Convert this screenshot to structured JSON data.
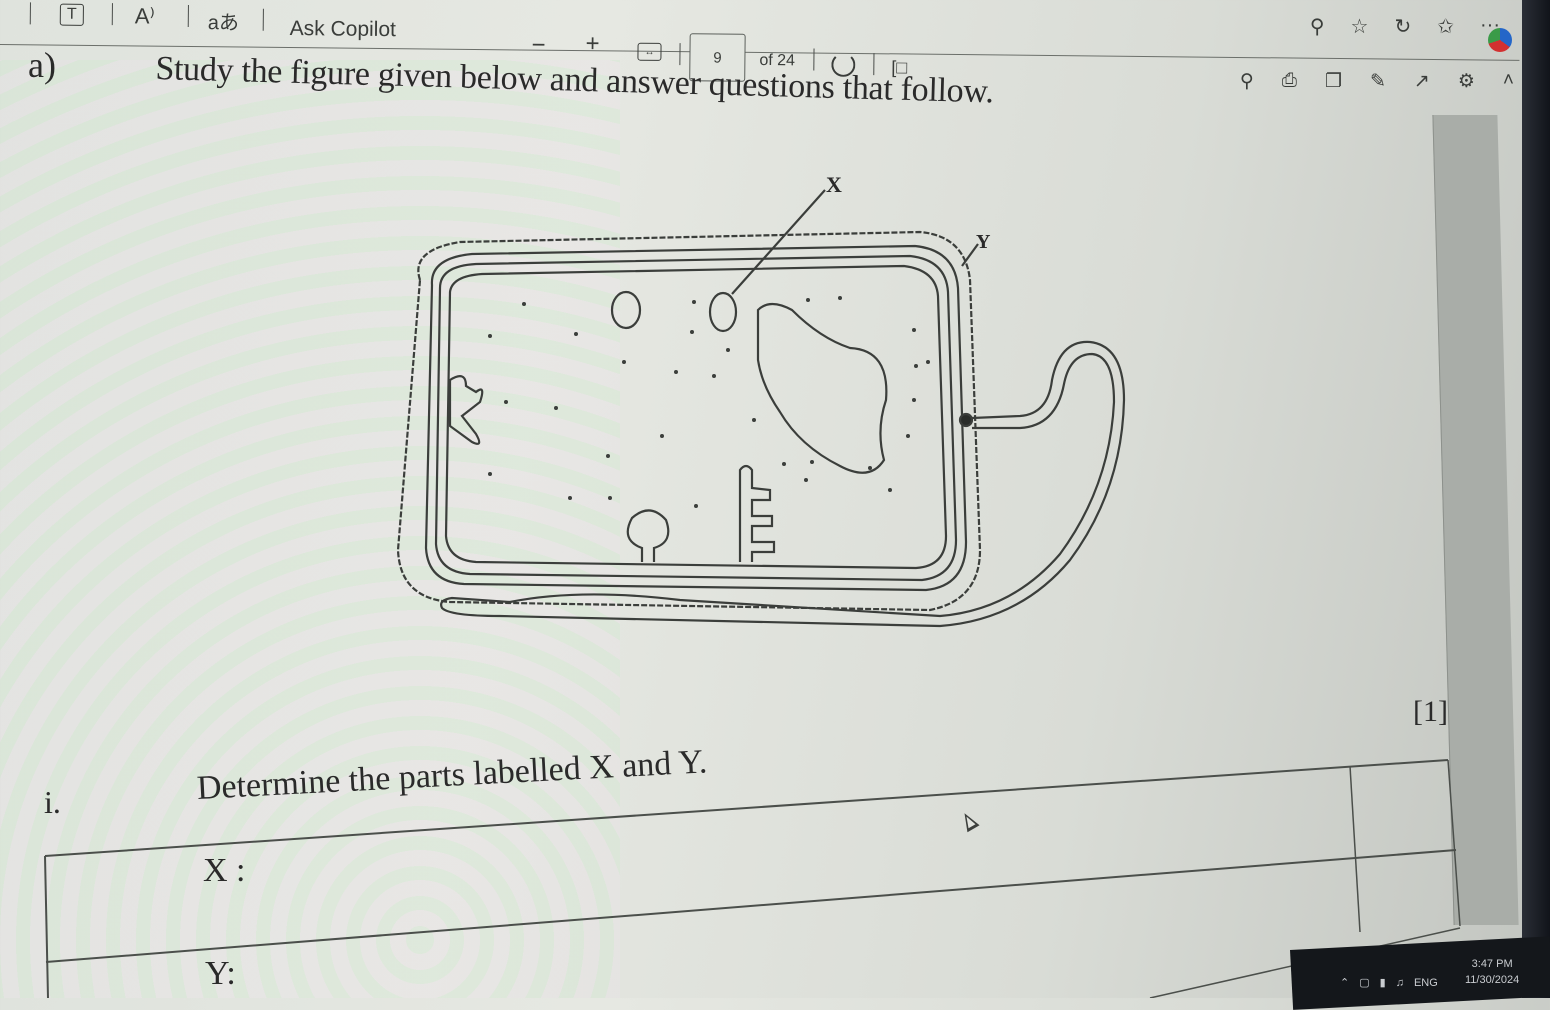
{
  "toolbar": {
    "icons": {
      "text_options": "T",
      "read_aloud": "A⁾",
      "translate": "aあ",
      "zoom_out": "−",
      "zoom_in": "+",
      "fit_width": "↔",
      "rotate": "↻",
      "page_view": "[□"
    },
    "ask_copilot": "Ask Copilot",
    "page_number": "9",
    "page_total": "of 24"
  },
  "browser_icons": {
    "row1": [
      "⚲",
      "☆",
      "↻",
      "✩",
      "···"
    ],
    "row1_names": [
      "search-page-icon",
      "favorite-star-icon",
      "refresh-icon",
      "favorites-bar-icon",
      "more-options-icon"
    ],
    "row2": [
      "⚲",
      "⎙",
      "❐",
      "✎",
      "↗",
      "⚙",
      "˄"
    ],
    "row2_names": [
      "find-icon",
      "print-icon",
      "save-icon",
      "save-as-icon",
      "draw-icon",
      "settings-icon",
      "collapse-toolbar-icon"
    ]
  },
  "document": {
    "part_label": "a)",
    "heading": "Study the figure given below and answer questions that follow.",
    "figure_labels": {
      "x": "X",
      "y": "Y"
    },
    "marks": "[1]",
    "question_number": "i.",
    "question_text": "Determine the parts labelled X and Y.",
    "answers": {
      "x_label": "X :",
      "y_label": "Y:"
    }
  },
  "taskbar": {
    "language": "ENG",
    "time": "3:47 PM",
    "date": "11/30/2024",
    "tray_icons": [
      "⌃",
      "▢",
      "▮",
      "♫"
    ]
  }
}
